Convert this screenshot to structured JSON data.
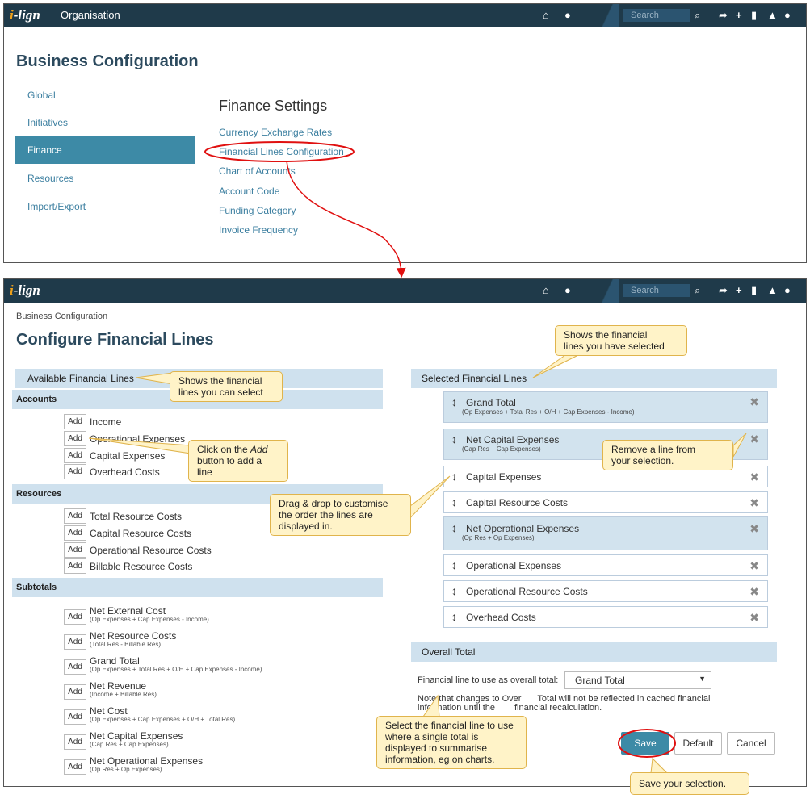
{
  "brand": {
    "logo_i": "i",
    "logo_rest": "-lign"
  },
  "top": {
    "title": "Organisation",
    "search_placeholder": "Search",
    "page_title": "Business Configuration",
    "nav": [
      "Global",
      "Initiatives",
      "Finance",
      "Resources",
      "Import/Export"
    ],
    "settings_title": "Finance Settings",
    "links": [
      "Currency Exchange Rates",
      "Financial Lines Configuration",
      "Chart of Accounts",
      "Account Code",
      "Funding Category",
      "Invoice Frequency"
    ]
  },
  "bottom": {
    "search_placeholder": "Search",
    "breadcrumb": "Business Configuration",
    "page_title": "Configure Financial Lines",
    "available_title": "Available Financial Lines",
    "add_label": "Add",
    "accounts_label": "Accounts",
    "accounts": [
      "Income",
      "Operational Expenses",
      "Capital Expenses",
      "Overhead Costs"
    ],
    "resources_label": "Resources",
    "resources": [
      "Total Resource Costs",
      "Capital Resource Costs",
      "Operational Resource Costs",
      "Billable Resource Costs"
    ],
    "subtotals_label": "Subtotals",
    "subtotals": [
      {
        "name": "Net External Cost",
        "formula": "(Op Expenses + Cap Expenses - Income)"
      },
      {
        "name": "Net Resource Costs",
        "formula": "(Total Res - Billable Res)"
      },
      {
        "name": "Grand Total",
        "formula": "(Op Expenses + Total Res + O/H + Cap Expenses - Income)"
      },
      {
        "name": "Net Revenue",
        "formula": "(Income + Billable Res)"
      },
      {
        "name": "Net Cost",
        "formula": "(Op Expenses + Cap Expenses + O/H + Total Res)"
      },
      {
        "name": "Net Capital Expenses",
        "formula": "(Cap Res + Cap Expenses)"
      },
      {
        "name": "Net Operational Expenses",
        "formula": "(Op Res + Op Expenses)"
      }
    ],
    "selected_title": "Selected Financial Lines",
    "selected": [
      {
        "name": "Grand Total",
        "formula": "(Op Expenses + Total Res + O/H + Cap Expenses - Income)"
      },
      {
        "name": "Net Capital Expenses",
        "formula": "(Cap Res + Cap Expenses)"
      },
      {
        "name": "Capital Expenses",
        "formula": ""
      },
      {
        "name": "Capital Resource Costs",
        "formula": ""
      },
      {
        "name": "Net Operational Expenses",
        "formula": "(Op Res + Op Expenses)"
      },
      {
        "name": "Operational Expenses",
        "formula": ""
      },
      {
        "name": "Operational Resource Costs",
        "formula": ""
      },
      {
        "name": "Overhead Costs",
        "formula": ""
      }
    ],
    "overall_title": "Overall Total",
    "overall_label": "Financial line to use as overall total:",
    "overall_value": "Grand Total",
    "note_line1": "Note that changes to Over",
    "note_line1b": "Total will not be reflected in cached financial",
    "note_line2": "information until the",
    "note_line2b": "financial recalculation.",
    "save": "Save",
    "default": "Default",
    "cancel": "Cancel"
  },
  "callouts": {
    "available_1": "Shows the financial",
    "available_2": "lines you can select",
    "selected_1": "Shows the financial",
    "selected_2": "lines you have selected",
    "add_1": "Click on the",
    "add_em": "Add",
    "add_2": "button to add a line",
    "remove_1": "Remove a line from",
    "remove_2": "your selection.",
    "drag": "Drag & drop to customise the order the lines are displayed in.",
    "overall": "Select the financial line to use where a single total is displayed to summarise information, eg on charts.",
    "save": "Save your selection."
  },
  "colors": {
    "topbar": "#1f3a4a",
    "accent": "#3d8aa6",
    "section": "#cfe1ee",
    "link": "#3c7fa0",
    "callout": "#fff3c8",
    "annotation": "#e01010"
  }
}
